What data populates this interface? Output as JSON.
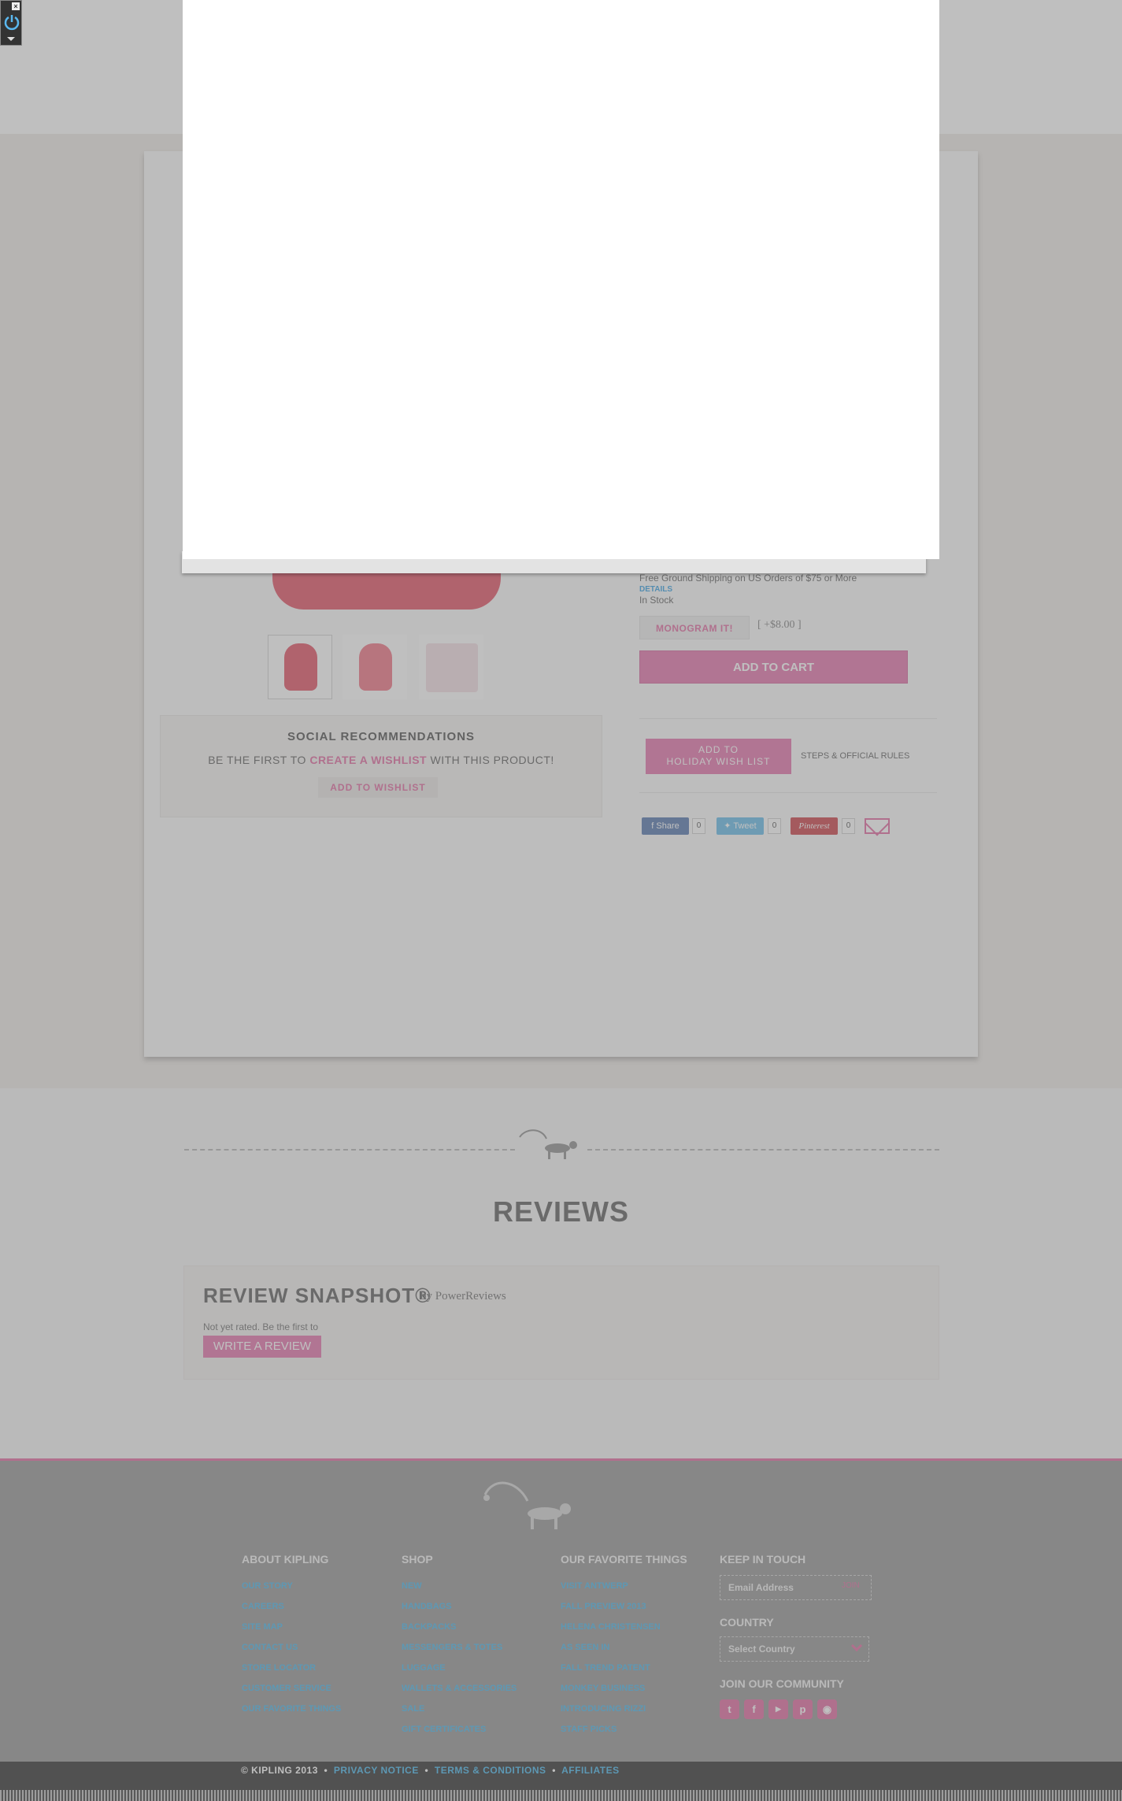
{
  "product": {
    "shipping_text": "Free Ground Shipping on US Orders of $75 or More",
    "shipping_link": "DETAILS",
    "stock_status": "In Stock",
    "monogram_label": "MONOGRAM IT!",
    "monogram_price": "[ +$8.00 ]",
    "add_to_cart_label": "ADD TO CART",
    "holiday_line1": "ADD TO",
    "holiday_line2": "HOLIDAY WISH LIST",
    "steps_rules": "STEPS & OFFICIAL RULES",
    "share": {
      "facebook_label": "Share",
      "facebook_count": "0",
      "twitter_label": "Tweet",
      "twitter_count": "0",
      "pinterest_label": "Pinterest",
      "pinterest_count": "0"
    },
    "thumbnails": [
      "bag-front",
      "bag-back",
      "bag-interior"
    ]
  },
  "social": {
    "title": "SOCIAL RECOMMENDATIONS",
    "line_prefix": "BE THE FIRST TO",
    "line_link": "CREATE A WISHLIST",
    "line_suffix": "WITH THIS PRODUCT!",
    "wishlist_button": "ADD TO WISHLIST"
  },
  "reviews": {
    "title": "REVIEWS",
    "snapshot_title": "REVIEW SNAPSHOT®",
    "snapshot_by": "by PowerReviews",
    "note": "Not yet rated. Be the first to",
    "write_button": "WRITE A REVIEW"
  },
  "footer": {
    "columns": [
      {
        "heading": "ABOUT KIPLING",
        "links": [
          "OUR STORY",
          "CAREERS",
          "SITE MAP",
          "CONTACT US",
          "STORE LOCATOR",
          "CUSTOMER SERVICE",
          "OUR FAVORITE THINGS"
        ]
      },
      {
        "heading": "SHOP",
        "links": [
          "NEW",
          "HANDBAGS",
          "BACKPACKS",
          "MESSENGERS & TOTES",
          "LUGGAGE",
          "WALLETS & ACCESSORIES",
          "SALE",
          "GIFT CERTIFICATES"
        ]
      },
      {
        "heading": "OUR FAVORITE THINGS",
        "links": [
          "VISIT ANTWERP",
          "FALL PREVIEW 2013",
          "HELENA CHRISTENSEN",
          "AS SEEN IN",
          "FALL TREND PATENT",
          "MONKEY BUSINESS",
          "INTRODUCING RIZZI",
          "STAFF PICKS"
        ]
      }
    ],
    "keep_in_touch": "KEEP IN TOUCH",
    "email_placeholder": "Email Address",
    "join_label": "JOIN",
    "country_heading": "COUNTRY",
    "country_select": "Select Country",
    "community_heading": "JOIN OUR COMMUNITY",
    "social_icons": [
      "twitter-icon",
      "facebook-icon",
      "youtube-icon",
      "pinterest-icon",
      "instagram-icon"
    ]
  },
  "legal": {
    "copyright": "© KIPLING 2013",
    "privacy": "PRIVACY NOTICE",
    "terms": "TERMS & CONDITIONS",
    "affiliates": "AFFILIATES"
  },
  "colors": {
    "brand_pink": "#e36ba6",
    "link_blue": "#3ab0e8",
    "overlay": "rgba(128,128,128,0.5)"
  }
}
